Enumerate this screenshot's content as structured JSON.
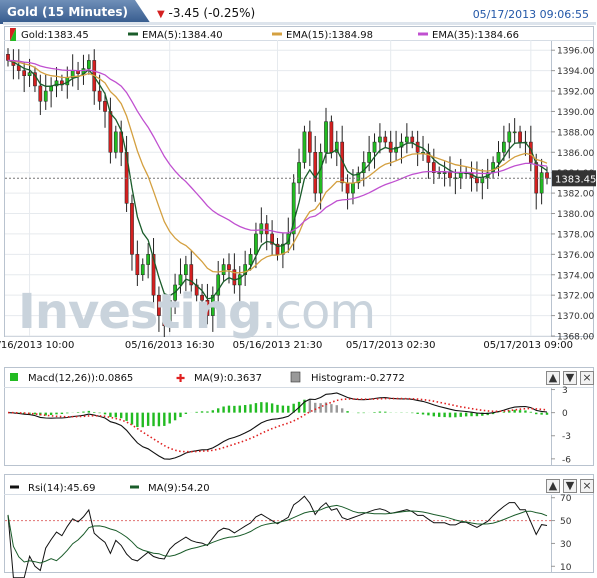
{
  "header": {
    "title": "Gold (15 Minutes)",
    "change": "-3.45 (-0.25%)",
    "datetime": "05/17/2013 09:06:55"
  },
  "legend_main": [
    {
      "label": "Gold:1383.45",
      "color": "#111111",
      "kind": "candle"
    },
    {
      "label": "EMA(5):1384.40",
      "color": "#1a5c2a",
      "kind": "line"
    },
    {
      "label": "EMA(15):1384.98",
      "color": "#d4a040",
      "kind": "line"
    },
    {
      "label": "EMA(35):1384.66",
      "color": "#c050d0",
      "kind": "line"
    }
  ],
  "legend_macd": [
    {
      "label": "Macd(12,26)):0.0865",
      "color": "#22bb22"
    },
    {
      "label": "MA(9):0.3637",
      "color": "#e02020"
    },
    {
      "label": "Histogram:-0.2772",
      "color": "#999999"
    }
  ],
  "legend_rsi": [
    {
      "label": "Rsi(14):45.69",
      "color": "#111111"
    },
    {
      "label": "MA(9):54.20",
      "color": "#1a5c2a"
    }
  ],
  "price_tag": "1383.45",
  "watermark": {
    "main": "Investing",
    "suffix": ".com"
  },
  "buttons": {
    "up": "▲",
    "down": "▼",
    "close": "×"
  },
  "colors": {
    "up_candle": "#22bb22",
    "down_candle": "#d42020",
    "ema5": "#1a5c2a",
    "ema15": "#d4a040",
    "ema35": "#c050d0",
    "macd_line": "#111111",
    "macd_signal": "#e02020",
    "hist_pos": "#22bb22",
    "hist_gray": "#999999",
    "rsi": "#111111",
    "rsi_ma": "#1a5c2a"
  },
  "chart_data": [
    {
      "type": "candlestick",
      "title": "Gold (15 Minutes)",
      "ylim": [
        1368,
        1397
      ],
      "ytick_labels": [
        "1396.00",
        "1394.00",
        "1392.00",
        "1390.00",
        "1388.00",
        "1386.00",
        "1384.00",
        "1382.00",
        "1380.00",
        "1378.00",
        "1376.00",
        "1374.00",
        "1372.00",
        "1370.00",
        "1368.00"
      ],
      "yticks": [
        1396,
        1394,
        1392,
        1390,
        1388,
        1386,
        1384,
        1382,
        1380,
        1378,
        1376,
        1374,
        1372,
        1370,
        1368
      ],
      "xtick_labels": [
        "05/16/2013 10:00",
        "05/16/2013 16:30",
        "05/16/2013 21:30",
        "05/17/2013 02:30",
        "05/17/2013 09:00"
      ],
      "xtick_index": [
        4,
        30,
        50,
        71,
        97
      ],
      "last_price": 1383.45,
      "closes": [
        1395,
        1394.5,
        1394,
        1393.5,
        1393.8,
        1392.5,
        1391,
        1392,
        1392.5,
        1393,
        1392.6,
        1393.3,
        1394,
        1393.7,
        1394.2,
        1395,
        1392,
        1391,
        1390,
        1386,
        1388,
        1386,
        1381,
        1376,
        1374,
        1375,
        1376,
        1372,
        1370,
        1369,
        1371.5,
        1373,
        1374,
        1375,
        1373,
        1372,
        1371.5,
        1370,
        1372,
        1374,
        1375,
        1374.5,
        1373,
        1374,
        1375,
        1376,
        1378,
        1379,
        1378,
        1377,
        1376,
        1377,
        1378,
        1383,
        1385,
        1388,
        1386,
        1382,
        1386,
        1389,
        1386,
        1387,
        1383,
        1382,
        1383,
        1384,
        1385,
        1386,
        1387,
        1387.5,
        1387,
        1386,
        1386.5,
        1387,
        1387.5,
        1387,
        1386,
        1386,
        1385,
        1384,
        1384,
        1384,
        1383.5,
        1383.5,
        1384,
        1384,
        1383.5,
        1383,
        1383.5,
        1384,
        1385,
        1386,
        1387,
        1388,
        1388,
        1387,
        1387,
        1385,
        1382,
        1384,
        1383.45
      ],
      "ema5_end": 1384.4,
      "ema15_end": 1384.98,
      "ema35_end": 1384.66
    },
    {
      "type": "macd",
      "ylim": [
        -6.8,
        3.2
      ],
      "ytick_labels": [
        "3",
        "0",
        "-3",
        "-6"
      ],
      "yticks": [
        3,
        0,
        -3,
        -6
      ],
      "macd_end": 0.0865,
      "signal_end": 0.3637,
      "histogram_end": -0.2772
    },
    {
      "type": "rsi",
      "ylim": [
        5,
        75
      ],
      "ytick_labels": [
        "70",
        "50",
        "30",
        "10"
      ],
      "yticks": [
        70,
        50,
        30,
        10
      ],
      "rsi_end": 45.69,
      "ma_end": 54.2
    }
  ]
}
